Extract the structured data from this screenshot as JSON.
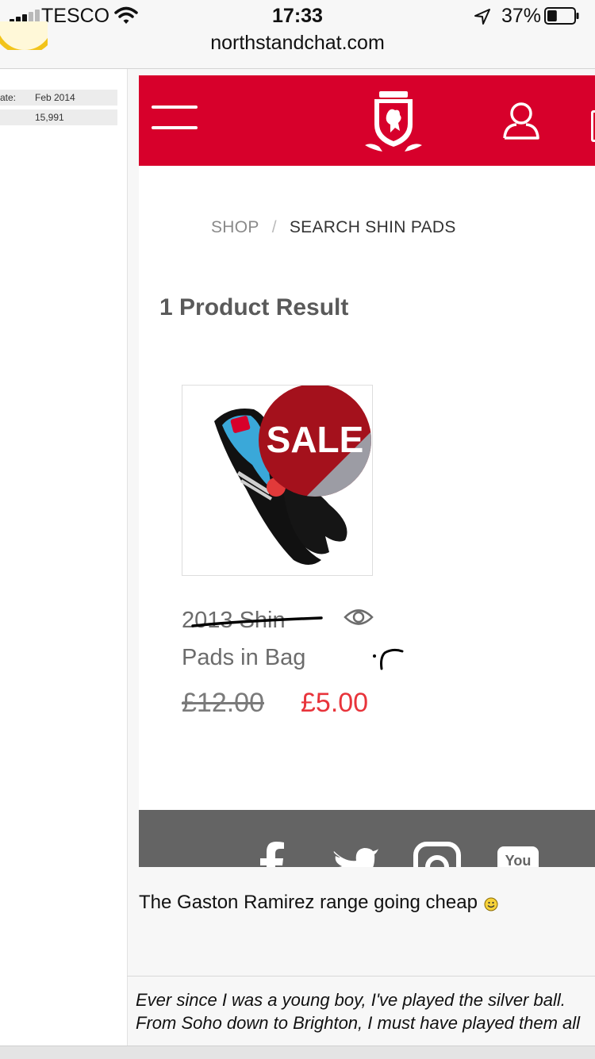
{
  "status_bar": {
    "carrier": "TESCO",
    "time": "17:33",
    "battery": "37%",
    "battery_level": 0.37,
    "signal_bars_active": 3,
    "signal_bars_total": 5
  },
  "browser": {
    "url": "northstandchat.com"
  },
  "forum_user_info": [
    {
      "label": "ate:",
      "value": "Feb 2014"
    },
    {
      "label": "",
      "value": "15,991"
    }
  ],
  "shop": {
    "header_color": "#d7002b",
    "breadcrumb": {
      "root": "SHOP",
      "separator": "/",
      "current": "SEARCH SHIN PADS"
    },
    "results_title": "1 Product Result",
    "product": {
      "name": "2013 Shin Pads in Bag",
      "badge": "SALE",
      "price_was": "£12.00",
      "price_now": "£5.00",
      "price_now_color": "#e8343b"
    },
    "footer_icons": [
      "facebook-icon",
      "twitter-icon",
      "instagram-icon",
      "youtube-icon"
    ],
    "youtube_label": "You"
  },
  "post": {
    "text": "The Gaston Ramirez range going cheap",
    "emoji": "smiley-icon",
    "signature_lines": [
      "Ever since I was a young boy, I've played the silver ball.",
      "From Soho down to Brighton, I must have played them all"
    ]
  }
}
